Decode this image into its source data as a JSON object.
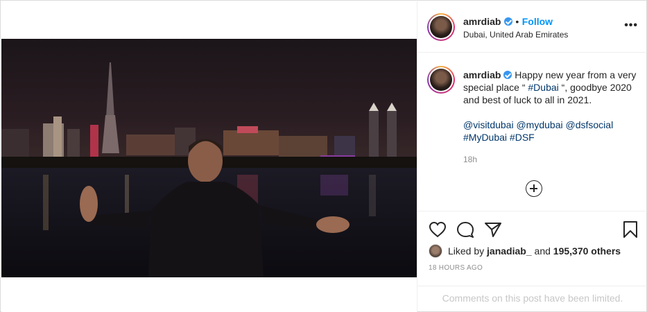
{
  "post": {
    "username": "amrdiab",
    "follow_label": "Follow",
    "separator": "•",
    "location": "Dubai, United Arab Emirates",
    "more_label": "•••"
  },
  "caption": {
    "username": "amrdiab",
    "text_part1": "Happy new year from a very special place “ ",
    "hashtag1": "#Dubai",
    "text_part2": " “, goodbye 2020 and best of luck to all in 2021.",
    "mentions": [
      "@visitdubai",
      "@mydubai",
      "@dsfsocial"
    ],
    "hashtags": [
      "#MyDubai",
      "#DSF"
    ],
    "time": "18h"
  },
  "likes": {
    "prefix": "Liked by",
    "first_user": "janadiab_",
    "conjunction": "and",
    "others": "195,370 others"
  },
  "posted_ago": "18 HOURS AGO",
  "comments_notice": "Comments on this post have been limited.",
  "icons": [
    "heart-icon",
    "comment-icon",
    "share-icon",
    "bookmark-icon",
    "add-comment-icon",
    "verified-icon"
  ],
  "colors": {
    "link_blue": "#0095f6",
    "verified_blue": "#3897f0",
    "tag_blue": "#00376b",
    "muted": "#8e8e8e"
  }
}
